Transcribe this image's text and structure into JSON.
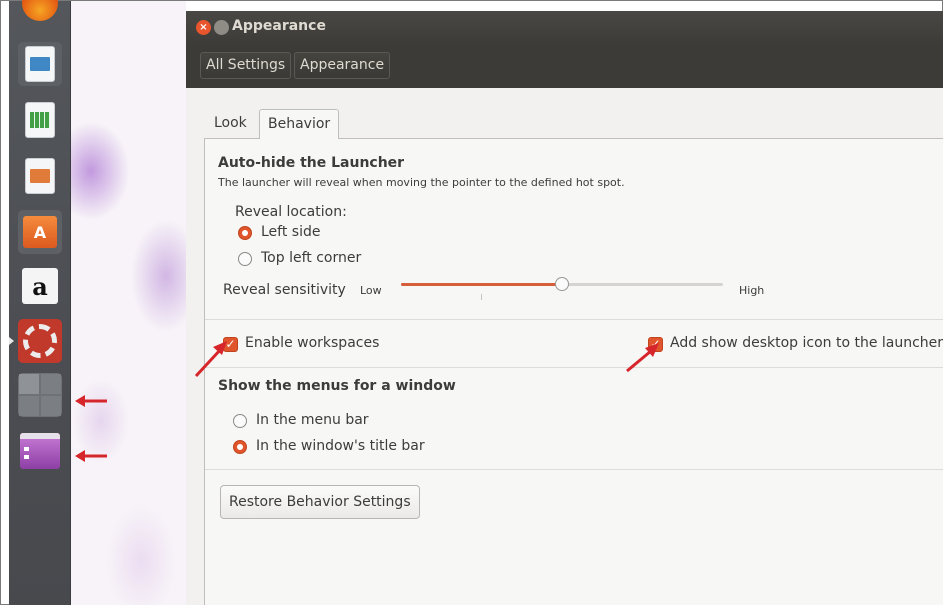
{
  "window": {
    "title": "Appearance",
    "close_glyph": "×"
  },
  "breadcrumb": {
    "all_settings": "All Settings",
    "appearance": "Appearance"
  },
  "tabs": {
    "look": "Look",
    "behavior": "Behavior",
    "active": "Behavior"
  },
  "autohide": {
    "heading": "Auto-hide the Launcher",
    "description": "The launcher will reveal when moving the pointer to the defined hot spot.",
    "reveal_location_label": "Reveal location:",
    "options": [
      "Left side",
      "Top left corner"
    ],
    "selected": "Left side",
    "sensitivity_label": "Reveal sensitivity",
    "sensitivity_low": "Low",
    "sensitivity_high": "High",
    "sensitivity_value": 0.5
  },
  "workspaces": {
    "enable_label": "Enable workspaces",
    "enabled": true,
    "show_desktop_label": "Add show desktop icon to the launcher",
    "show_desktop_enabled": true
  },
  "menus": {
    "heading": "Show the menus for a window",
    "options": [
      "In the menu bar",
      "In the window's title bar"
    ],
    "selected": "In the window's title bar"
  },
  "restore_button": "Restore Behavior Settings",
  "launcher_items": [
    "firefox-icon",
    "writer-icon",
    "calc-icon",
    "impress-icon",
    "software-center-icon",
    "amazon-icon",
    "system-settings-icon",
    "workspace-switcher-icon",
    "show-desktop-icon"
  ],
  "launcher_glyphs": {
    "software_center": "A",
    "amazon": "a"
  },
  "colors": {
    "accent": "#e0552b",
    "annotation_arrow": "#d7262b",
    "titlebar": "#3c3b37",
    "launcher": "#4f5155"
  }
}
